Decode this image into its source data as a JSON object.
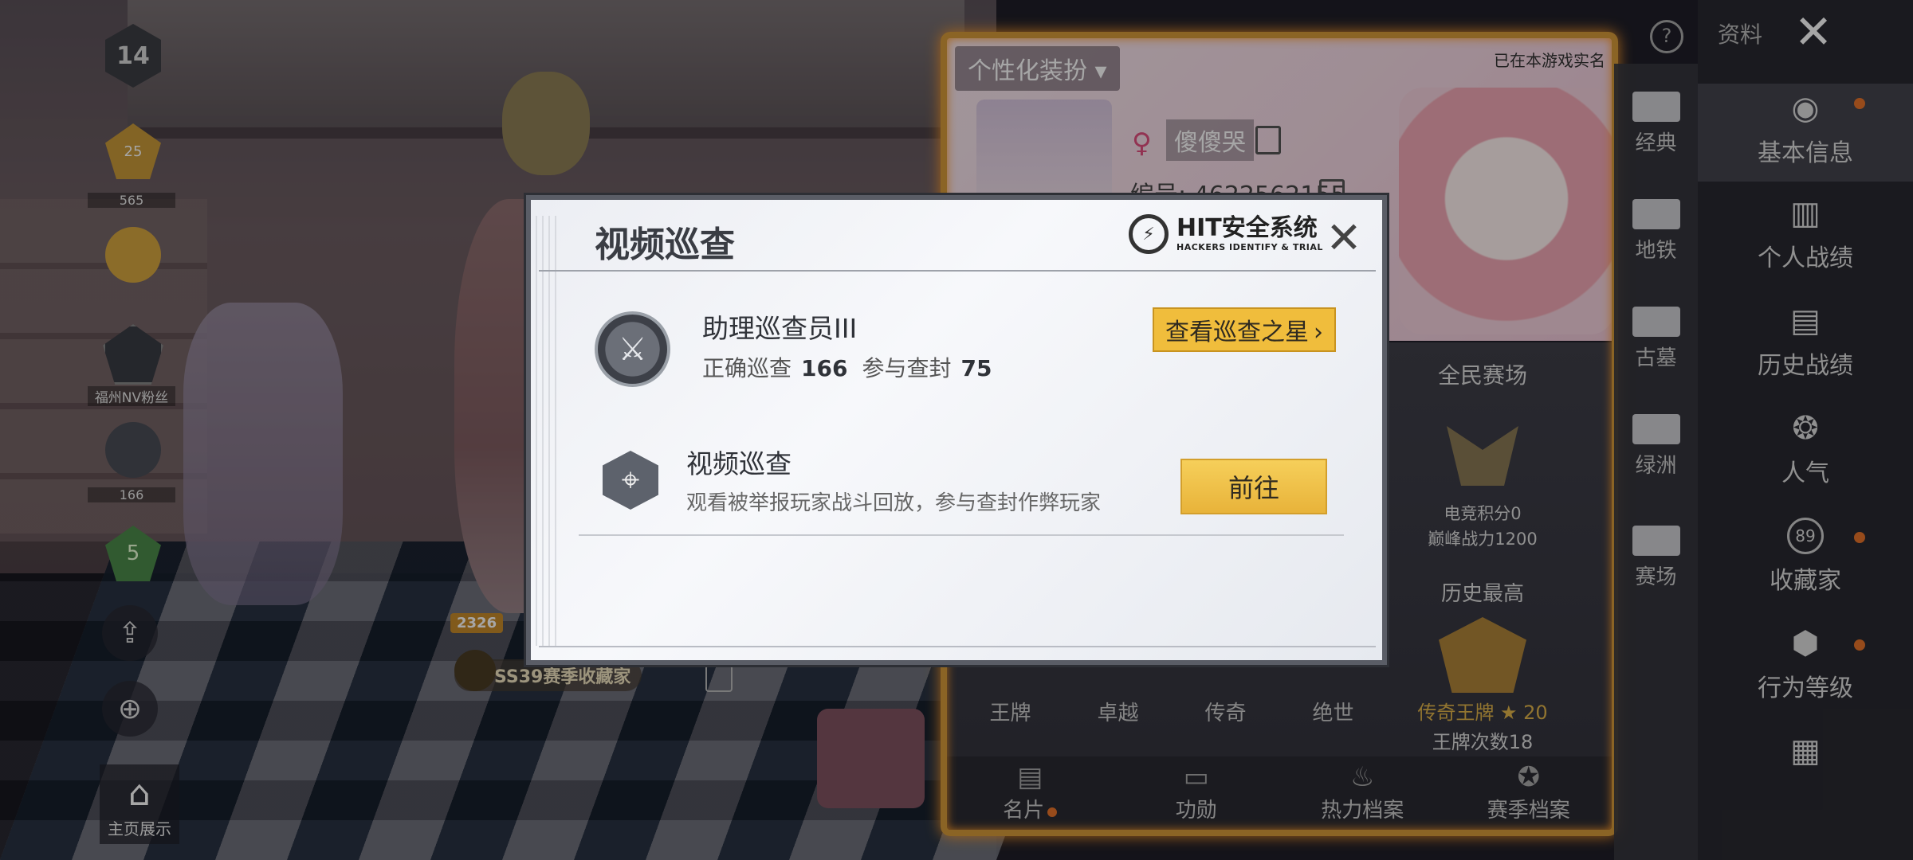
{
  "left_bar": {
    "level": "14",
    "rank_badge_number": "25",
    "rank_points": "565",
    "team_label": "福州NV粉丝",
    "patrol_count": "166",
    "shield_level": "5",
    "home_show_label": "主页展示"
  },
  "scene": {
    "score_tag": "2326",
    "collector_title": "SS39赛季收藏家"
  },
  "profile": {
    "dress_up_label": "个性化装扮",
    "realname_status": "已在本游戏实名",
    "gender_icon": "female-icon",
    "nickname": "傻傻哭",
    "uid_text": "编号: 4622562155",
    "arena_title": "全民赛场",
    "esports_points": "电竞积分0",
    "peak_power": "巅峰战力1200",
    "history_title": "历史最高",
    "history_rank": "传奇王牌",
    "history_stars": "20",
    "ace_count": "王牌次数18",
    "tiers": [
      "王牌",
      "卓越",
      "传奇",
      "绝世"
    ],
    "tabs": [
      {
        "label": "名片",
        "icon": "card-icon"
      },
      {
        "label": "功勋",
        "icon": "medal-icon"
      },
      {
        "label": "热力档案",
        "icon": "flame-icon"
      },
      {
        "label": "赛季档案",
        "icon": "season-icon"
      }
    ]
  },
  "sub_menu": {
    "items": [
      "经典",
      "地铁",
      "古墓",
      "绿洲",
      "赛场"
    ]
  },
  "main_menu": {
    "top_label": "资料",
    "items": [
      "基本信息",
      "个人战绩",
      "历史战绩",
      "人气",
      "收藏家",
      "行为等级"
    ],
    "collector_badge": "89"
  },
  "dialog": {
    "title": "视频巡查",
    "logo_text": "HIT安全系统",
    "logo_subtext": "HACKERS IDENTIFY & TRIAL",
    "rank_title": "助理巡查员III",
    "correct_label": "正确巡查",
    "correct_value": "166",
    "banned_label": "参与查封",
    "banned_value": "75",
    "star_button": "查看巡查之星",
    "patrol_title": "视频巡查",
    "patrol_desc": "观看被举报玩家战斗回放，参与查封作弊玩家",
    "go_button": "前往"
  },
  "colors": {
    "accent_gold": "#f0bd3c",
    "frame_orange": "#d69a3a",
    "notify_dot": "#e8742a"
  }
}
